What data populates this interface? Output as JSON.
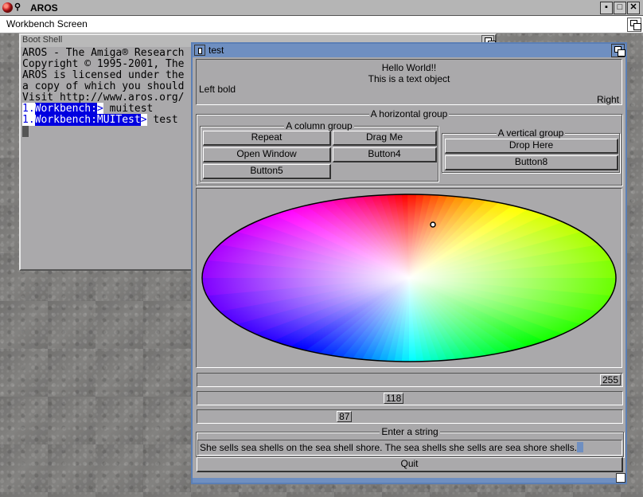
{
  "screen": {
    "title": "AROS"
  },
  "workbench": {
    "title": "Workbench Screen"
  },
  "shell": {
    "title": "Boot Shell",
    "lines": [
      "AROS - The Amiga® Research",
      "Copyright © 1995-2001, The",
      "AROS is licensed under the",
      "a copy of which you should",
      "Visit http://www.aros.org/"
    ],
    "prompt1_num": "1.",
    "prompt1_path": "Workbench:",
    "prompt1_cmd": " muitest",
    "prompt2_num": "1.",
    "prompt2_path": "Workbench:MUITest",
    "prompt2_cmd": " test"
  },
  "window": {
    "title": "test",
    "text_center1": "Hello World!!",
    "text_center2": "This is a text object",
    "text_left": "Left bold",
    "text_right": "Right",
    "hgroup_title": "A horizontal group",
    "colgroup_title": "A column group",
    "vgroup_title": "A vertical group",
    "buttons": {
      "repeat": "Repeat",
      "drag_me": "Drag Me",
      "open_window": "Open Window",
      "button4": "Button4",
      "button5": "Button5",
      "drop_here": "Drop Here",
      "button8": "Button8"
    },
    "slider1_value": "255",
    "slider1_fraction": 1.0,
    "slider2_value": "118",
    "slider2_fraction": 0.46,
    "slider3_value": "87",
    "slider3_fraction": 0.34,
    "string_group_title": "Enter a string",
    "string_value": "She sells sea shells on the sea shell shore. The sea shells she sells are sea shore shells.",
    "quit": "Quit"
  },
  "colors": {
    "title_active": "#6f8fc1",
    "panel_bg": "#aaa9ab",
    "console_highlight": "#0000e0"
  },
  "icons": [
    "aros-logo-icon",
    "pin-icon",
    "depth-icon",
    "zoom-icon",
    "close-icon",
    "size-icon"
  ]
}
